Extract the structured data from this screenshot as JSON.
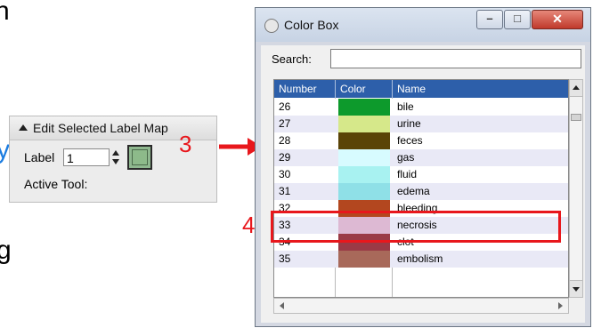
{
  "slide_fragments": [
    "n",
    "y",
    "g"
  ],
  "left_panel": {
    "header": "Edit Selected Label Map",
    "label_text": "Label",
    "label_value": "1",
    "swatch_color": "#8dba8a",
    "active_tool_text": "Active Tool:"
  },
  "callouts": {
    "step3": "3",
    "step4": "4",
    "accent": "#e8171c"
  },
  "color_box": {
    "title": "Color Box",
    "search_label": "Search:",
    "search_value": "",
    "columns": [
      "Number",
      "Color",
      "Name"
    ],
    "rows": [
      {
        "number": "26",
        "color": "#0d9a2c",
        "name": "bile"
      },
      {
        "number": "27",
        "color": "#d6e88a",
        "name": "urine"
      },
      {
        "number": "28",
        "color": "#5a4307",
        "name": "feces"
      },
      {
        "number": "29",
        "color": "#d7fbff",
        "name": "gas"
      },
      {
        "number": "30",
        "color": "#a8f2f1",
        "name": "fluid"
      },
      {
        "number": "31",
        "color": "#8fe0e7",
        "name": "edema"
      },
      {
        "number": "32",
        "color": "#b3471f",
        "name": "bleeding"
      },
      {
        "number": "33",
        "color": "#ddb9d3",
        "name": "necrosis"
      },
      {
        "number": "34",
        "color": "#9a3a46",
        "name": "clot"
      },
      {
        "number": "35",
        "color": "#a8695a",
        "name": "embolism"
      }
    ]
  }
}
